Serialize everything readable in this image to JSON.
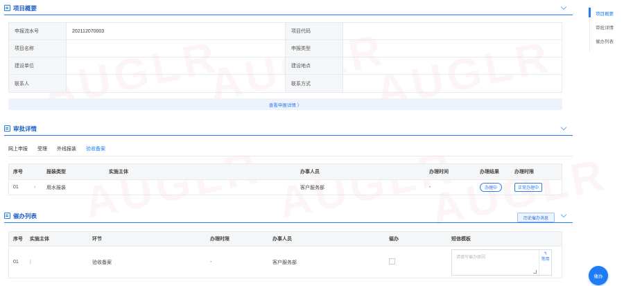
{
  "overview": {
    "title": "项目概要",
    "rows": [
      {
        "l1": "申报流水号",
        "v1": "202112070003",
        "l2": "项目代码",
        "v2": ""
      },
      {
        "l1": "项目名称",
        "v1": "",
        "l2": "申报类型",
        "v2": ""
      },
      {
        "l1": "建设单位",
        "v1": "",
        "l2": "建设地点",
        "v2": ""
      },
      {
        "l1": "联系人",
        "v1": "",
        "l2": "联系方式",
        "v2": ""
      }
    ],
    "detail_link": "查看申报详情 〉"
  },
  "approval": {
    "title": "审批详情",
    "tabs": [
      "网上申报",
      "受理",
      "外线报装",
      "验收备案"
    ],
    "active_tab": "验收备案",
    "headers": [
      "序号",
      "报装类型",
      "实施主体",
      "办事人员",
      "办理时间",
      "办理结果",
      "办理时限"
    ],
    "rows": [
      {
        "no": "01",
        "arrow": "›",
        "type": "用水报装",
        "subject": "",
        "staff": "客户服务部",
        "time": "-",
        "result": "办理中",
        "limit": "正常办理中"
      }
    ]
  },
  "urge": {
    "title": "催办列表",
    "history_button": "历史催办消息",
    "headers": [
      "序号",
      "实施主体",
      "环节",
      "办理时限",
      "办事人员",
      "催办",
      "短信模板"
    ],
    "rows": [
      {
        "no": "01",
        "subject": "|",
        "step": "验收备案",
        "limit": "-",
        "staff": "客户服务部"
      }
    ],
    "sms_placeholder": "请填写催办原因",
    "sms_action": "常用",
    "sms_icon": "↰"
  },
  "rightnav": {
    "items": [
      "项目概要",
      "审批详情",
      "催办列表"
    ],
    "active": "项目概要"
  },
  "fab_label": "催办",
  "watermark": "AUGLR",
  "colors": {
    "accent": "#1e7df5",
    "header_bg": "#f5f6f8",
    "border": "#e6e9ef"
  }
}
